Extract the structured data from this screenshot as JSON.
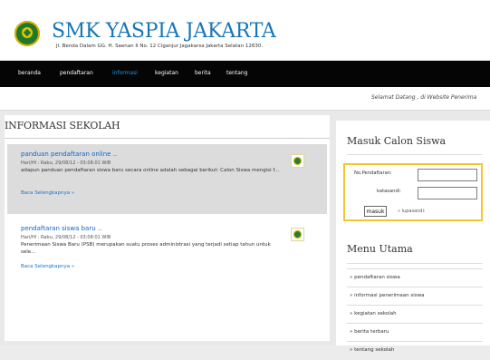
{
  "site": {
    "title": "SMK YASPIA JAKARTA",
    "address": "Jl. Benda Dalam GG. H. Saenan II No. 12 Ciganjur Jagakarsa Jakarta Selatan 12630."
  },
  "nav": [
    "beranda",
    "pendaftaran",
    "informasi",
    "kegiatan",
    "berita",
    "tentang"
  ],
  "ticker": "Selamat Datang , di Website Penerima",
  "main": {
    "section_title": "INFORMASI SEKOLAH",
    "posts": [
      {
        "title": "panduan pendaftaran online ..",
        "date": "Hari/Hl : Rabu, 29/08/12 - 03:08:01 WIB",
        "text": "adapun panduan pendaftaran siswa baru secara online adalah sebagai berikut: Calon Siswa mengisi f...",
        "read_more": "Baca Selengkapnya »"
      },
      {
        "title": "pendaftaran siswa baru ..",
        "date": "Hari/Hl : Rabu, 29/08/12 - 03:08:01 WIB",
        "text": "Penerimaan Siswa Baru (PSB) merupakan suatu proses administrasi yang terjadi setiap tahun untuk sele...",
        "read_more": "Baca Selengkapnya »"
      }
    ]
  },
  "sidebar": {
    "login_title": "Masuk Calon Siswa",
    "registration_label": "No.Pendaftaran:",
    "password_label": "katasandi:",
    "submit_label": "masuk",
    "forgot_label": "» lupasandi:",
    "menu_title": "Menu Utama",
    "menu_items": [
      "» pendaftaran siswa",
      "» informasi penerimaan siswa",
      "» kegiatan sekolah",
      "» berita terbaru",
      "» tentang sekolah"
    ]
  },
  "colors": {
    "brand": "#1776b6",
    "active_nav": "#1e97e8",
    "accent": "#f5c52e"
  }
}
